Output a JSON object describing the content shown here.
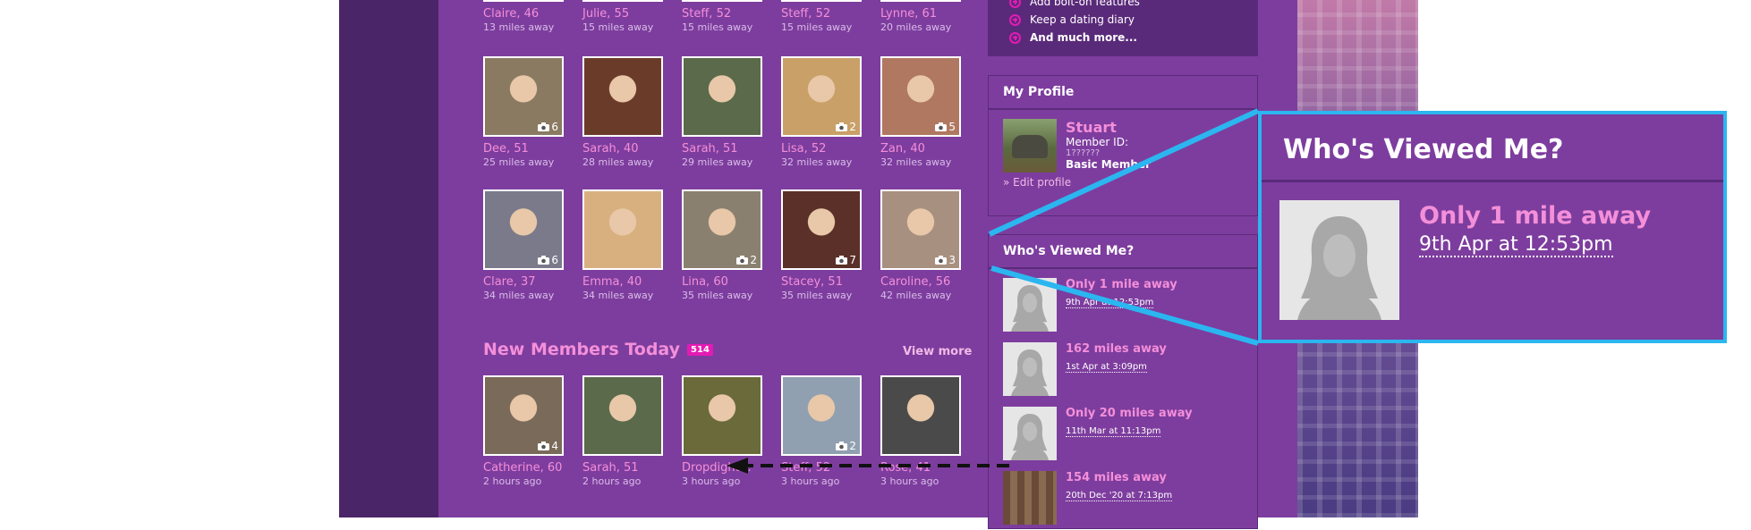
{
  "top_row": [
    {
      "name": "Claire, 46",
      "dist": "13 miles away"
    },
    {
      "name": "Julie, 55",
      "dist": "15 miles away"
    },
    {
      "name": "Steff, 52",
      "dist": "15 miles away"
    },
    {
      "name": "Steff, 52",
      "dist": "15 miles away"
    },
    {
      "name": "Lynne, 61",
      "dist": "20 miles away"
    }
  ],
  "row2": [
    {
      "name": "Dee, 51",
      "dist": "25 miles away",
      "photos": "6",
      "color": "#8a7a62"
    },
    {
      "name": "Sarah, 40",
      "dist": "28 miles away",
      "photos": "",
      "color": "#6b3b2a"
    },
    {
      "name": "Sarah, 51",
      "dist": "29 miles away",
      "photos": "",
      "color": "#5a6a4a"
    },
    {
      "name": "Lisa, 52",
      "dist": "32 miles away",
      "photos": "2",
      "color": "#c9a068"
    },
    {
      "name": "Zan, 40",
      "dist": "32 miles away",
      "photos": "5",
      "color": "#b07860"
    }
  ],
  "row3": [
    {
      "name": "Clare, 37",
      "dist": "34 miles away",
      "photos": "6",
      "color": "#7a7a8a"
    },
    {
      "name": "Emma, 40",
      "dist": "34 miles away",
      "photos": "",
      "color": "#d8b080"
    },
    {
      "name": "Lina, 60",
      "dist": "35 miles away",
      "photos": "2",
      "color": "#8a8070"
    },
    {
      "name": "Stacey, 51",
      "dist": "35 miles away",
      "photos": "7",
      "color": "#5a3028"
    },
    {
      "name": "Caroline, 56",
      "dist": "42 miles away",
      "photos": "3",
      "color": "#a89080"
    }
  ],
  "new_members": {
    "title": "New Members Today",
    "badge": "514",
    "view_more": "View more",
    "items": [
      {
        "name": "Catherine, 60",
        "dist": "2 hours ago",
        "photos": "4",
        "color": "#7a6a5a"
      },
      {
        "name": "Sarah, 51",
        "dist": "2 hours ago",
        "photos": "",
        "color": "#5a6a4a"
      },
      {
        "name": "Dropdight…",
        "dist": "3 hours ago",
        "photos": "",
        "color": "#6a6a3a"
      },
      {
        "name": "Steff, 52",
        "dist": "3 hours ago",
        "photos": "2",
        "color": "#90a0b0"
      },
      {
        "name": "Rose, 41",
        "dist": "3 hours ago",
        "photos": "",
        "color": "#4a4a4a"
      }
    ]
  },
  "upgrade_list": [
    "Add bolt-on features",
    "Keep a dating diary",
    "And much more..."
  ],
  "profile": {
    "heading": "My Profile",
    "name": "Stuart",
    "member_id_label": "Member ID:",
    "member_id": "1??????",
    "membership": "Basic Member",
    "edit": "» Edit profile"
  },
  "viewed": {
    "heading": "Who's Viewed Me?",
    "items": [
      {
        "dist": "Only 1 mile away",
        "time": "9th Apr at 12:53pm"
      },
      {
        "dist": "162 miles away",
        "time": "1st Apr at 3:09pm"
      },
      {
        "dist": "Only 20 miles away",
        "time": "11th Mar at 11:13pm"
      },
      {
        "dist": "154 miles away",
        "time": "20th Dec '20 at 7:13pm"
      }
    ]
  },
  "zoom": {
    "heading": "Who's Viewed Me?",
    "dist": "Only 1 mile away",
    "time": "9th Apr at 12:53pm"
  },
  "colors": {
    "accent": "#f48fd9",
    "background": "#7d3d9e",
    "callout": "#2bb6f0"
  }
}
